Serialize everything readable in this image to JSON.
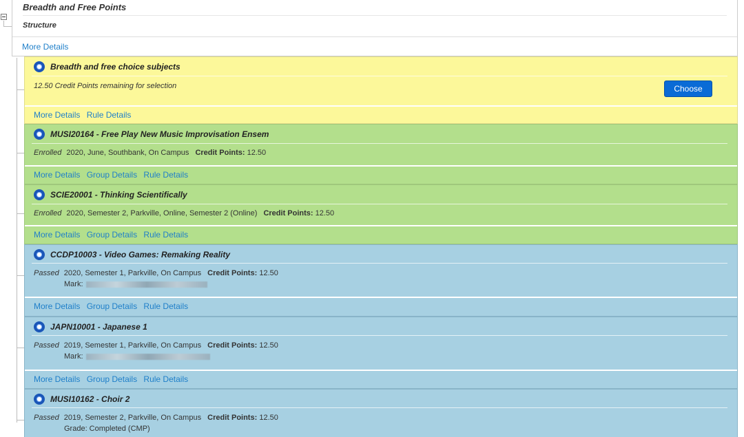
{
  "top": {
    "title": "Breadth and Free Points",
    "structure": "Structure",
    "more_details": "More Details"
  },
  "panels": [
    {
      "color": "#fcf89a",
      "title": "Breadth and free choice subjects",
      "detail": "12.50 Credit Points remaining for selection",
      "button": "Choose",
      "links": [
        "More Details",
        "Rule Details"
      ]
    },
    {
      "color": "#b3df8c",
      "title": "MUSI20164 - Free Play New Music Improvisation Ensem",
      "status": "Enrolled",
      "info": "2020, June, Southbank, On Campus",
      "cp_label": "Credit Points:",
      "cp_value": "12.50",
      "links": [
        "More Details",
        "Group Details",
        "Rule Details"
      ]
    },
    {
      "color": "#b3df8c",
      "title": "SCIE20001 - Thinking Scientifically",
      "status": "Enrolled",
      "info": "2020, Semester 2, Parkville, Online, Semester 2 (Online)",
      "cp_label": "Credit Points:",
      "cp_value": "12.50",
      "links": [
        "More Details",
        "Group Details",
        "Rule Details"
      ]
    },
    {
      "color": "#a7d0e2",
      "title": "CCDP10003 - Video Games: Remaking Reality",
      "status": "Passed",
      "info": "2020, Semester 1, Parkville, On Campus",
      "cp_label": "Credit Points:",
      "cp_value": "12.50",
      "mark_label": "Mark:",
      "links": [
        "More Details",
        "Group Details",
        "Rule Details"
      ]
    },
    {
      "color": "#a7d0e2",
      "title": "JAPN10001 - Japanese 1",
      "status": "Passed",
      "info": "2019, Semester 1, Parkville, On Campus",
      "cp_label": "Credit Points:",
      "cp_value": "12.50",
      "mark_label": "Mark:",
      "links": [
        "More Details",
        "Group Details",
        "Rule Details"
      ]
    },
    {
      "color": "#a7d0e2",
      "title": "MUSI10162 - Choir 2",
      "status": "Passed",
      "info": "2019, Semester 2, Parkville, On Campus",
      "cp_label": "Credit Points:",
      "cp_value": "12.50",
      "grade": "Grade: Completed (CMP)"
    }
  ]
}
